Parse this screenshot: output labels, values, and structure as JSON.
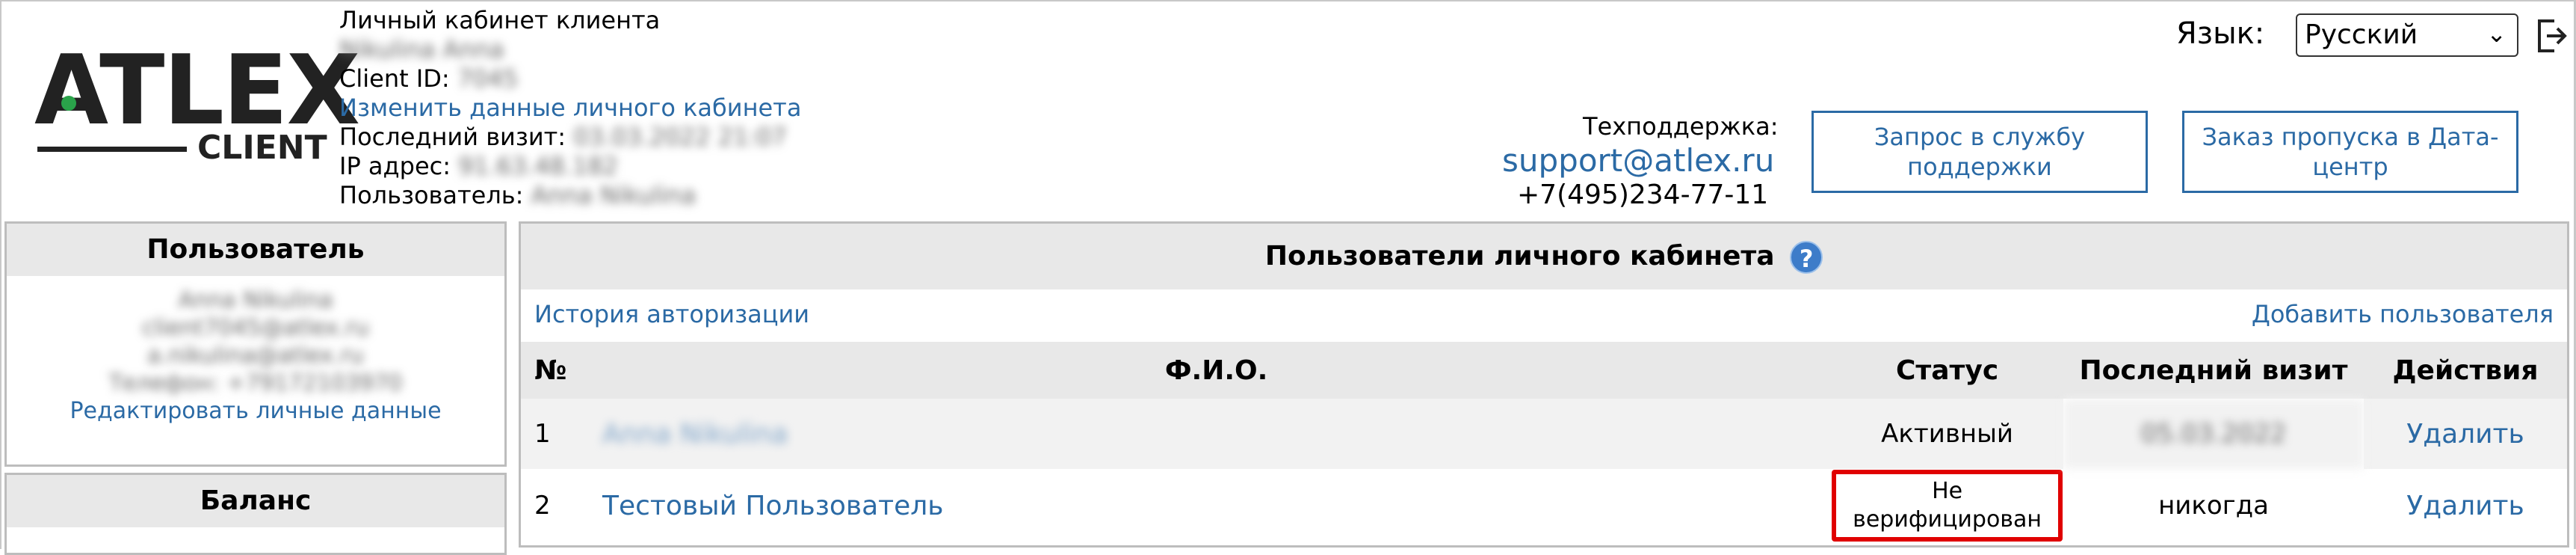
{
  "logo": {
    "main": "ATLEX",
    "sub": "CLIENT"
  },
  "header": {
    "title": "Личный кабинет клиента",
    "name": "Nikulina Anna",
    "client_id_label": "Client ID:",
    "client_id": "7045",
    "edit_link": "Изменить данные личного кабинета",
    "last_visit_label": "Последний визит:",
    "last_visit": "03.03.2022 21:07",
    "ip_label": "IP адрес:",
    "ip": "91.63.48.182",
    "user_label": "Пользователь:",
    "user": "Anna Nikulina"
  },
  "language": {
    "label": "Язык:",
    "selected": "Русский"
  },
  "support": {
    "label": "Техподдержка:",
    "email": "support@atlex.ru",
    "phone": "+7(495)234-77-11",
    "request_button": "Запрос в службу поддержки",
    "pass_button": "Заказ пропуска в Дата-центр"
  },
  "user_panel": {
    "title": "Пользователь",
    "name": "Anna Nikulina",
    "email1": "client7045@atlex.ru",
    "email2": "a.nikulina@atlex.ru",
    "phone": "Телефон: +79172103970",
    "edit_link": "Редактировать личные данные"
  },
  "balance_panel": {
    "title": "Баланс"
  },
  "main": {
    "title": "Пользователи личного кабинета",
    "help": "?",
    "history_link": "История авторизации",
    "add_user_link": "Добавить пользователя",
    "columns": [
      "№",
      "Ф.И.О.",
      "Статус",
      "Последний визит",
      "Действия"
    ],
    "rows": [
      {
        "num": "1",
        "name": "Anna Nikulina",
        "status": "Активный",
        "last_visit": "05.03.2022",
        "action": "Удалить"
      },
      {
        "num": "2",
        "name": "Тестовый Пользователь",
        "status_line1": "Не",
        "status_line2": "верифицирован",
        "last_visit": "никогда",
        "action": "Удалить"
      }
    ]
  },
  "colors": {
    "link": "#2b6aa5",
    "highlight": "#e00000",
    "header_bg": "#e8e8e8"
  }
}
